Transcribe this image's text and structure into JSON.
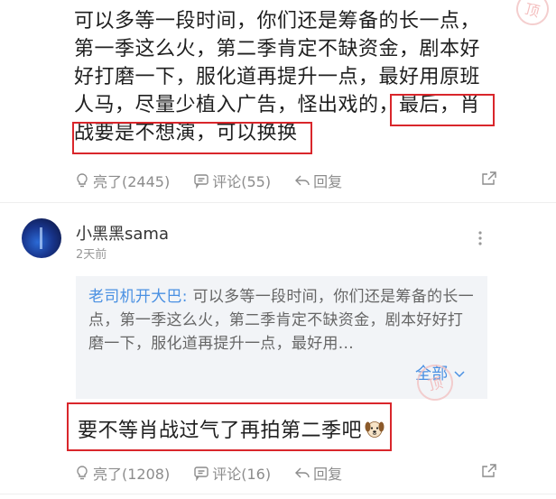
{
  "comment1": {
    "text": "可以多等一段时间，你们还是筹备的长一点，第一季这么火，第二季肯定不缺资金，剧本好好打磨一下，服化道再提升一点，最好用原班人马，尽量少植入广告，怪出戏的，最后，肖战要是不想演，可以换换",
    "actions": {
      "like_label": "亮了(2445)",
      "comment_label": "评论(55)",
      "reply_label": "回复"
    }
  },
  "comment2": {
    "username": "小黑黑sama",
    "time": "2天前",
    "quote": {
      "author": "老司机开大巴:",
      "text": " 可以多等一段时间，你们还是筹备的长一点，第一季这么火，第二季肯定不缺资金，剧本好好打磨一下，服化道再提升一点，最好用...",
      "expand_label": "全部"
    },
    "reply_text": "要不等肖战过气了再拍第二季吧",
    "actions": {
      "like_label": "亮了(1208)",
      "comment_label": "评论(16)",
      "reply_label": "回复"
    }
  },
  "watermark_text": "顶",
  "colors": {
    "highlight": "#d9262b",
    "link": "#4a90e2",
    "muted": "#8c8c8c",
    "quote_bg": "#f2f4f7"
  },
  "icons": [
    "lightbulb-icon",
    "comment-icon",
    "reply-icon",
    "share-icon",
    "more-vertical-icon",
    "chevron-down-icon",
    "dog-emoji-icon"
  ]
}
